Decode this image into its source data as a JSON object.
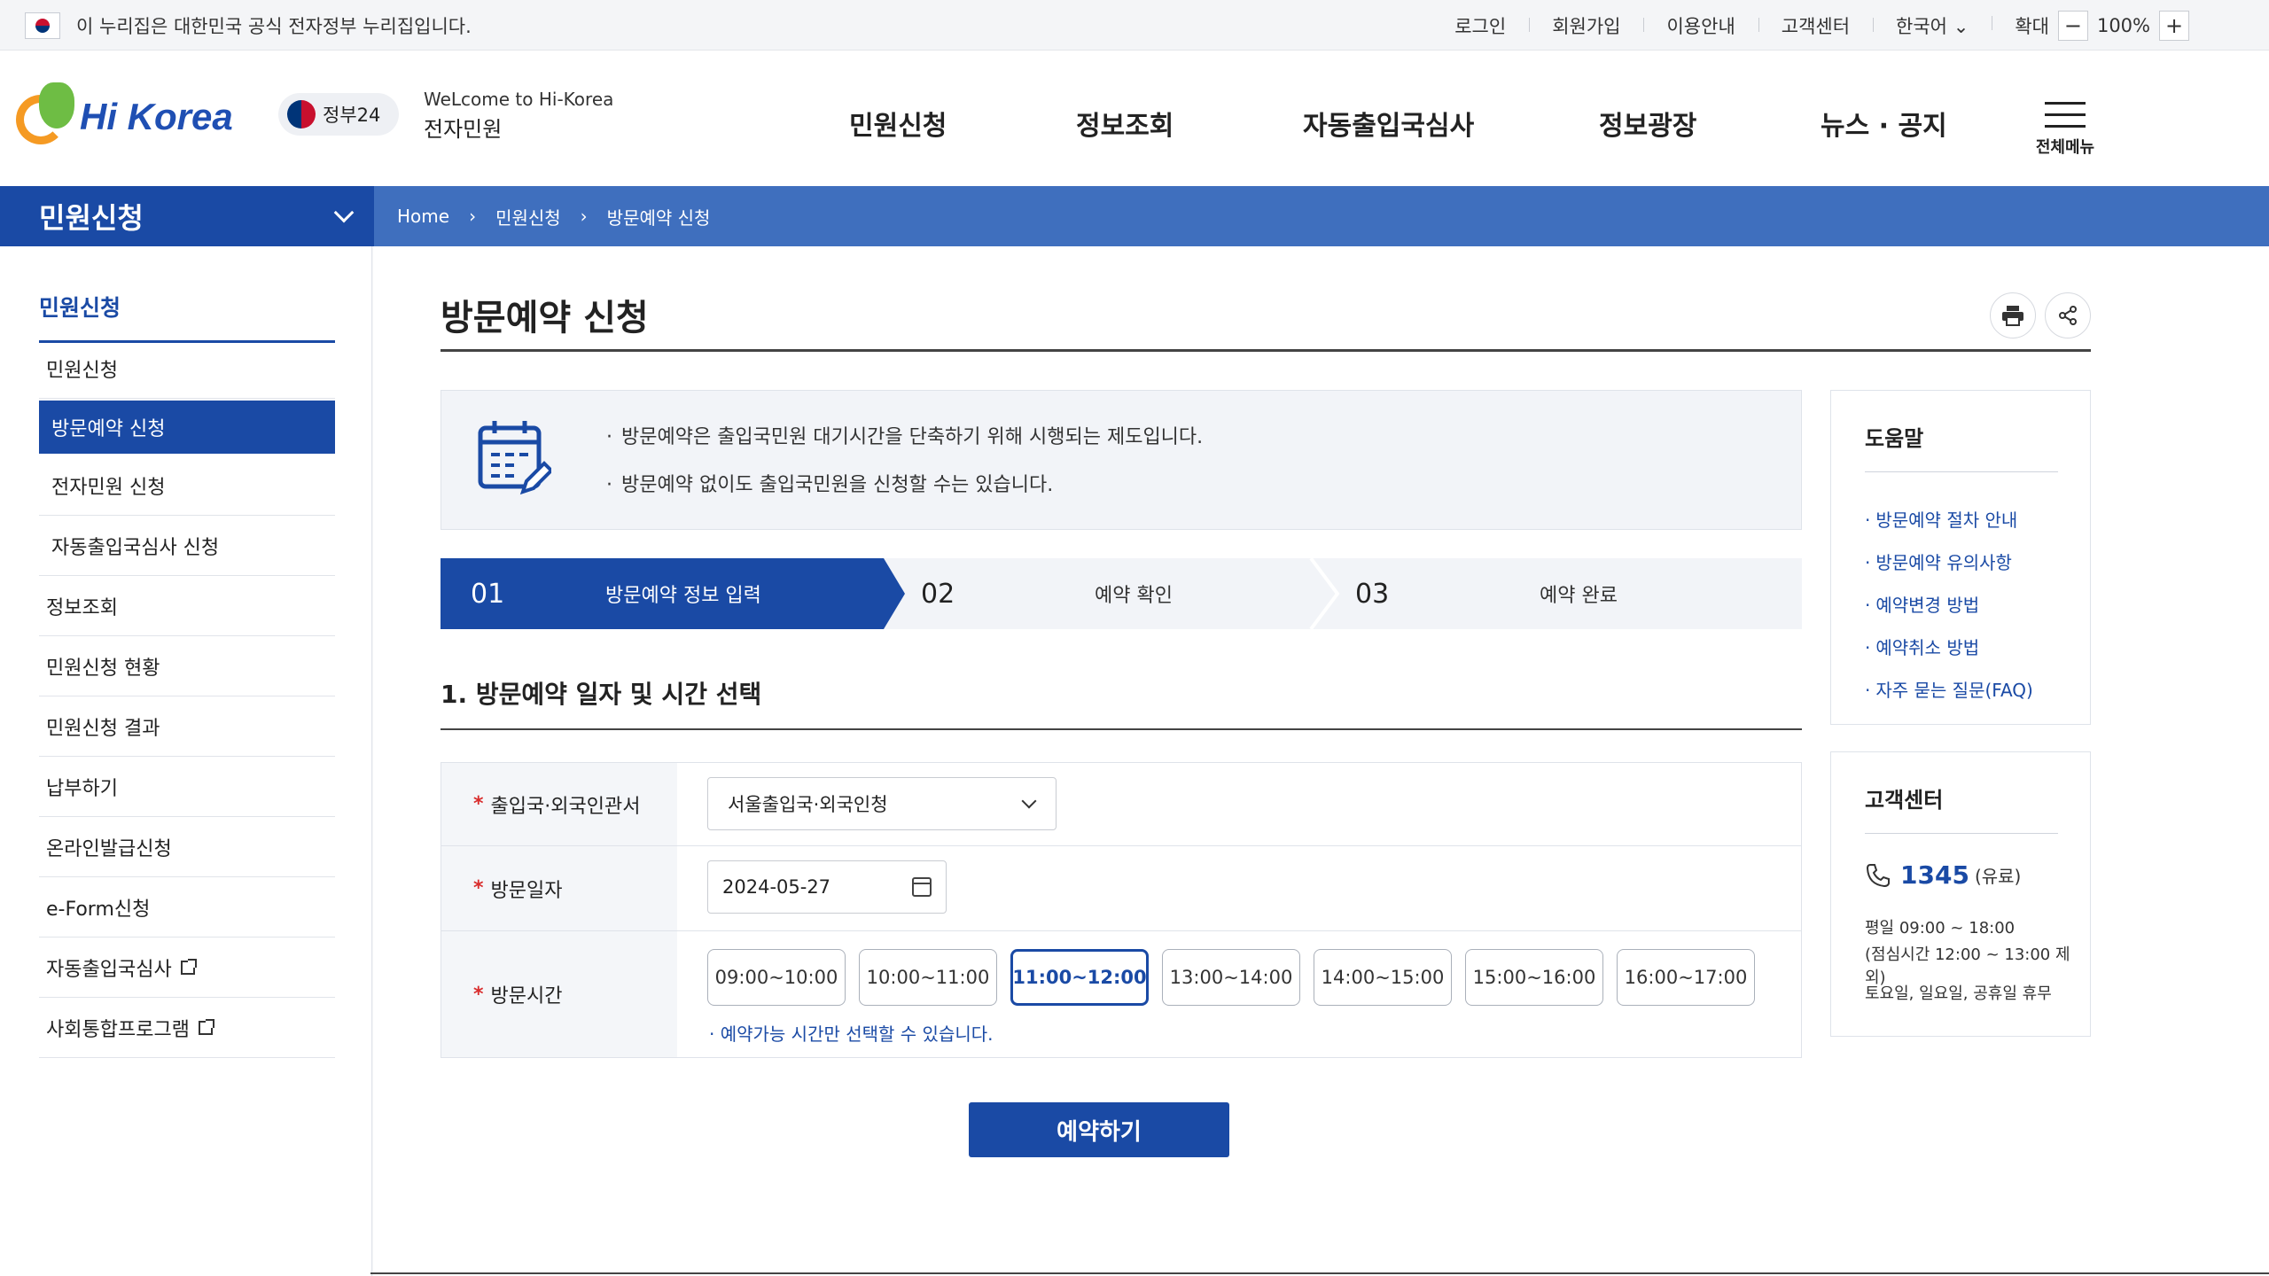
{
  "govbar": {
    "notice": "이 누리집은 대한민국 공식 전자정부 누리집입니다.",
    "links": [
      "로그인",
      "회원가입",
      "이용안내",
      "고객센터",
      "한국어"
    ],
    "zoom_label": "확대",
    "zoom_value": "100%"
  },
  "header": {
    "brand": "Hi Korea",
    "gov24": "정부24",
    "welcome_line1": "WeLcome to Hi-Korea",
    "welcome_line2": "전자민원",
    "gnb": [
      "민원신청",
      "정보조회",
      "자동출입국심사",
      "정보광장",
      "뉴스 · 공지"
    ],
    "all_menu": "전체메뉴"
  },
  "band": {
    "section": "민원신청",
    "breadcrumb": [
      "Home",
      "민원신청",
      "방문예약 신청"
    ]
  },
  "sidebar": {
    "title": "민원신청",
    "items": [
      {
        "label": "민원신청"
      },
      {
        "label": "방문예약 신청"
      },
      {
        "label": "전자민원 신청"
      },
      {
        "label": "자동출입국심사 신청"
      },
      {
        "label": "정보조회"
      },
      {
        "label": "민원신청 현황"
      },
      {
        "label": "민원신청 결과"
      },
      {
        "label": "납부하기"
      },
      {
        "label": "온라인발급신청"
      },
      {
        "label": "e-Form신청"
      },
      {
        "label": "자동출입국심사"
      },
      {
        "label": "사회통합프로그램"
      }
    ]
  },
  "main": {
    "title": "방문예약 신청",
    "notice_lines": [
      "방문예약은 출입국민원 대기시간을 단축하기 위해 시행되는 제도입니다.",
      "방문예약 없이도 출입국민원을 신청할 수는 있습니다."
    ],
    "steps": [
      {
        "no": "01",
        "label": "방문예약 정보 입력"
      },
      {
        "no": "02",
        "label": "예약 확인"
      },
      {
        "no": "03",
        "label": "예약 완료"
      }
    ],
    "section_title": "1. 방문예약 일자 및 시간 선택",
    "form": {
      "office_label": "출입국·외국인관서",
      "office_value": "서울출입국·외국인청",
      "date_label": "방문일자",
      "date_value": "2024-05-27",
      "time_label": "방문시간",
      "slots": [
        "09:00~10:00",
        "10:00~11:00",
        "11:00~12:00",
        "13:00~14:00",
        "14:00~15:00",
        "15:00~16:00",
        "16:00~17:00"
      ],
      "selected_slot": "11:00~12:00",
      "hint": "예약가능 시간만 선택할 수 있습니다."
    },
    "submit": "예약하기"
  },
  "help": {
    "title": "도움말",
    "links": [
      "방문예약 절차 안내",
      "방문예약 유의사항",
      "예약변경 방법",
      "예약취소 방법",
      "자주 묻는 질문(FAQ)"
    ]
  },
  "cs": {
    "title": "고객센터",
    "phone": "1345",
    "paid": "(유료)",
    "hours1": "평일 09:00 ~ 18:00",
    "hours2": "(점심시간 12:00 ~ 13:00 제외)",
    "closed": "토요일, 일요일, 공휴일 휴무"
  },
  "colors": {
    "primary": "#1a4aa5",
    "band": "#3f6fbe",
    "required": "#d92d2d"
  }
}
